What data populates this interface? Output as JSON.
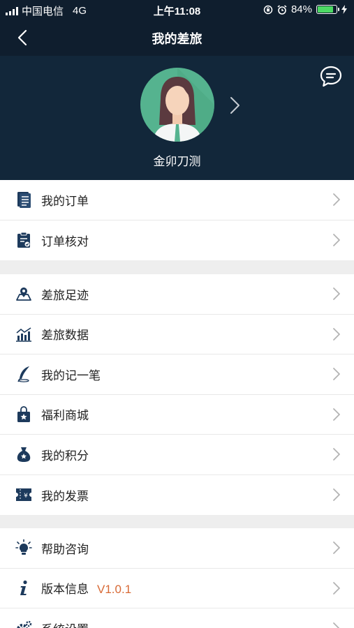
{
  "status_bar": {
    "carrier": "中国电信",
    "network": "4G",
    "time": "上午11:08",
    "battery_percent": "84%",
    "battery_level": 0.84
  },
  "nav": {
    "back_icon": "chevron-left-icon",
    "title": "我的差旅"
  },
  "profile": {
    "message_icon": "chat-bubble-icon",
    "avatar_icon": "female-avatar-icon",
    "username": "金卯刀测"
  },
  "groups": [
    {
      "items": [
        {
          "label": "我的订单",
          "icon": "order-list-icon"
        },
        {
          "label": "订单核对",
          "icon": "clipboard-check-icon"
        }
      ]
    },
    {
      "items": [
        {
          "label": "差旅足迹",
          "icon": "map-pin-icon"
        },
        {
          "label": "差旅数据",
          "icon": "bar-chart-icon"
        },
        {
          "label": "我的记一笔",
          "icon": "quill-pen-icon"
        },
        {
          "label": "福利商城",
          "icon": "shopping-bag-icon"
        },
        {
          "label": "我的积分",
          "icon": "money-bag-icon"
        },
        {
          "label": "我的发票",
          "icon": "invoice-icon"
        }
      ]
    },
    {
      "items": [
        {
          "label": "帮助咨询",
          "icon": "lightbulb-icon"
        },
        {
          "label": "版本信息",
          "icon": "info-icon",
          "extra": "V1.0.1"
        },
        {
          "label": "系统设置",
          "icon": "gear-icon"
        }
      ]
    }
  ],
  "colors": {
    "header_bg": "#0f1e2e",
    "profile_bg": "#12273a",
    "icon_color": "#1d3a5c",
    "version_color": "#d86a36",
    "battery_green": "#4cd964"
  }
}
